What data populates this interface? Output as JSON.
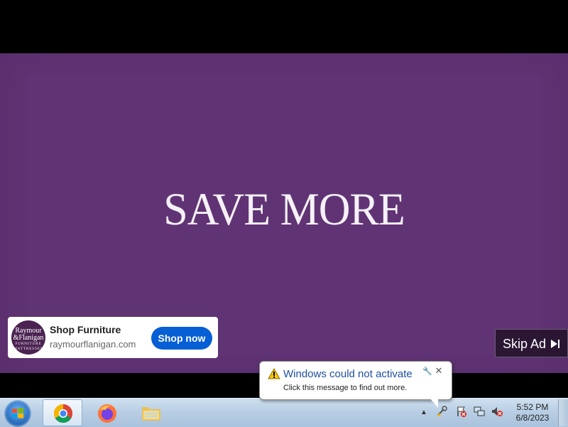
{
  "video": {
    "headline": "SAVE MORE",
    "background_color": "#5a2e6c"
  },
  "ad_card": {
    "logo_line1": "Raymour",
    "logo_line2": "&Flanigan",
    "logo_line3": "FURNITURE",
    "logo_line4": "MATTRESSES",
    "title": "Shop Furniture",
    "url": "raymourflanigan.com",
    "cta_label": "Shop now"
  },
  "skip_ad": {
    "label": "Skip Ad",
    "icon": "skip-next-icon"
  },
  "notification": {
    "title": "Windows could not activate",
    "message": "Click this message to find out more.",
    "icon": "warning-icon"
  },
  "taskbar": {
    "pinned": [
      {
        "name": "Google Chrome",
        "icon": "chrome-icon",
        "active": true
      },
      {
        "name": "Firefox",
        "icon": "firefox-icon",
        "active": false
      },
      {
        "name": "Windows Explorer",
        "icon": "folder-icon",
        "active": false
      }
    ],
    "tray_icons": [
      "action-center-icon",
      "network-icon",
      "volume-muted-icon",
      "activation-warning-icon"
    ],
    "clock": {
      "time": "5:52 PM",
      "date": "6/8/2023"
    }
  },
  "colors": {
    "accent_blue": "#065fd4",
    "notification_title": "#1e4fa0",
    "taskbar": "#b7cde3"
  }
}
